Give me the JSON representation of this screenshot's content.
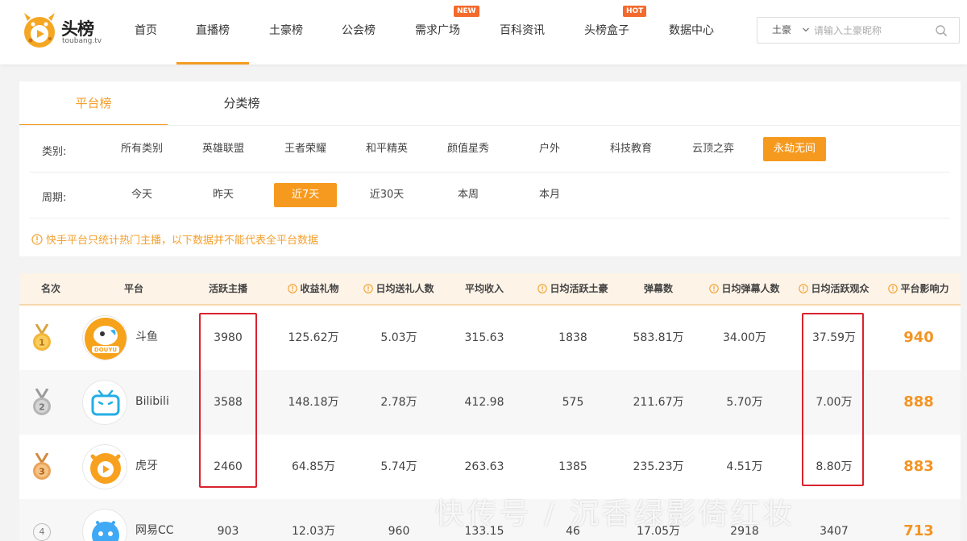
{
  "header": {
    "logo": {
      "title": "头榜",
      "subtitle": "toubang.tv"
    },
    "nav": [
      {
        "label": "首页"
      },
      {
        "label": "直播榜",
        "active": true
      },
      {
        "label": "土豪榜"
      },
      {
        "label": "公会榜"
      },
      {
        "label": "需求广场",
        "badge": "NEW"
      },
      {
        "label": "百科资讯"
      },
      {
        "label": "头榜盒子",
        "badge": "HOT"
      },
      {
        "label": "数据中心"
      }
    ],
    "search": {
      "type": "土豪",
      "placeholder": "请输入土豪昵称",
      "value": ""
    }
  },
  "panel": {
    "tabs": [
      {
        "label": "平台榜",
        "active": true
      },
      {
        "label": "分类榜"
      }
    ],
    "category": {
      "label": "类别:",
      "options": [
        "所有类别",
        "英雄联盟",
        "王者荣耀",
        "和平精英",
        "颜值星秀",
        "户外",
        "科技教育",
        "云顶之弈",
        "永劫无间"
      ],
      "selected": "永劫无间"
    },
    "period": {
      "label": "周期:",
      "options": [
        "今天",
        "昨天",
        "近7天",
        "近30天",
        "本周",
        "本月"
      ],
      "selected": "近7天"
    },
    "notice": "快手平台只统计热门主播，以下数据并不能代表全平台数据"
  },
  "table": {
    "columns": [
      "名次",
      "平台",
      "活跃主播",
      "收益礼物",
      "日均送礼人数",
      "平均收入",
      "日均活跃土豪",
      "弹幕数",
      "日均弹幕人数",
      "日均活跃观众",
      "平台影响力"
    ],
    "rows": [
      {
        "rank": "1",
        "platform": "斗鱼",
        "active_anchors": "3980",
        "gift_income": "125.62万",
        "daily_gifters": "5.03万",
        "avg_income": "315.63",
        "daily_tycoons": "1838",
        "danmaku": "583.81万",
        "daily_danmaku_users": "34.00万",
        "daily_viewers": "37.59万",
        "influence": "940"
      },
      {
        "rank": "2",
        "platform": "Bilibili",
        "active_anchors": "3588",
        "gift_income": "148.18万",
        "daily_gifters": "2.78万",
        "avg_income": "412.98",
        "daily_tycoons": "575",
        "danmaku": "211.67万",
        "daily_danmaku_users": "5.70万",
        "daily_viewers": "7.00万",
        "influence": "888"
      },
      {
        "rank": "3",
        "platform": "虎牙",
        "active_anchors": "2460",
        "gift_income": "64.85万",
        "daily_gifters": "5.74万",
        "avg_income": "263.63",
        "daily_tycoons": "1385",
        "danmaku": "235.23万",
        "daily_danmaku_users": "4.51万",
        "daily_viewers": "8.80万",
        "influence": "883"
      },
      {
        "rank": "4",
        "platform": "网易CC",
        "active_anchors": "903",
        "gift_income": "12.03万",
        "daily_gifters": "960",
        "avg_income": "133.15",
        "daily_tycoons": "46",
        "danmaku": "17.05万",
        "daily_danmaku_users": "2918",
        "daily_viewers": "3407",
        "influence": "713"
      }
    ]
  },
  "watermark": "快传号 / 沉香绿影倚红妆",
  "colors": {
    "accent": "#f49c24",
    "highlight": "#d9232e",
    "badge": "#f36a2c"
  }
}
